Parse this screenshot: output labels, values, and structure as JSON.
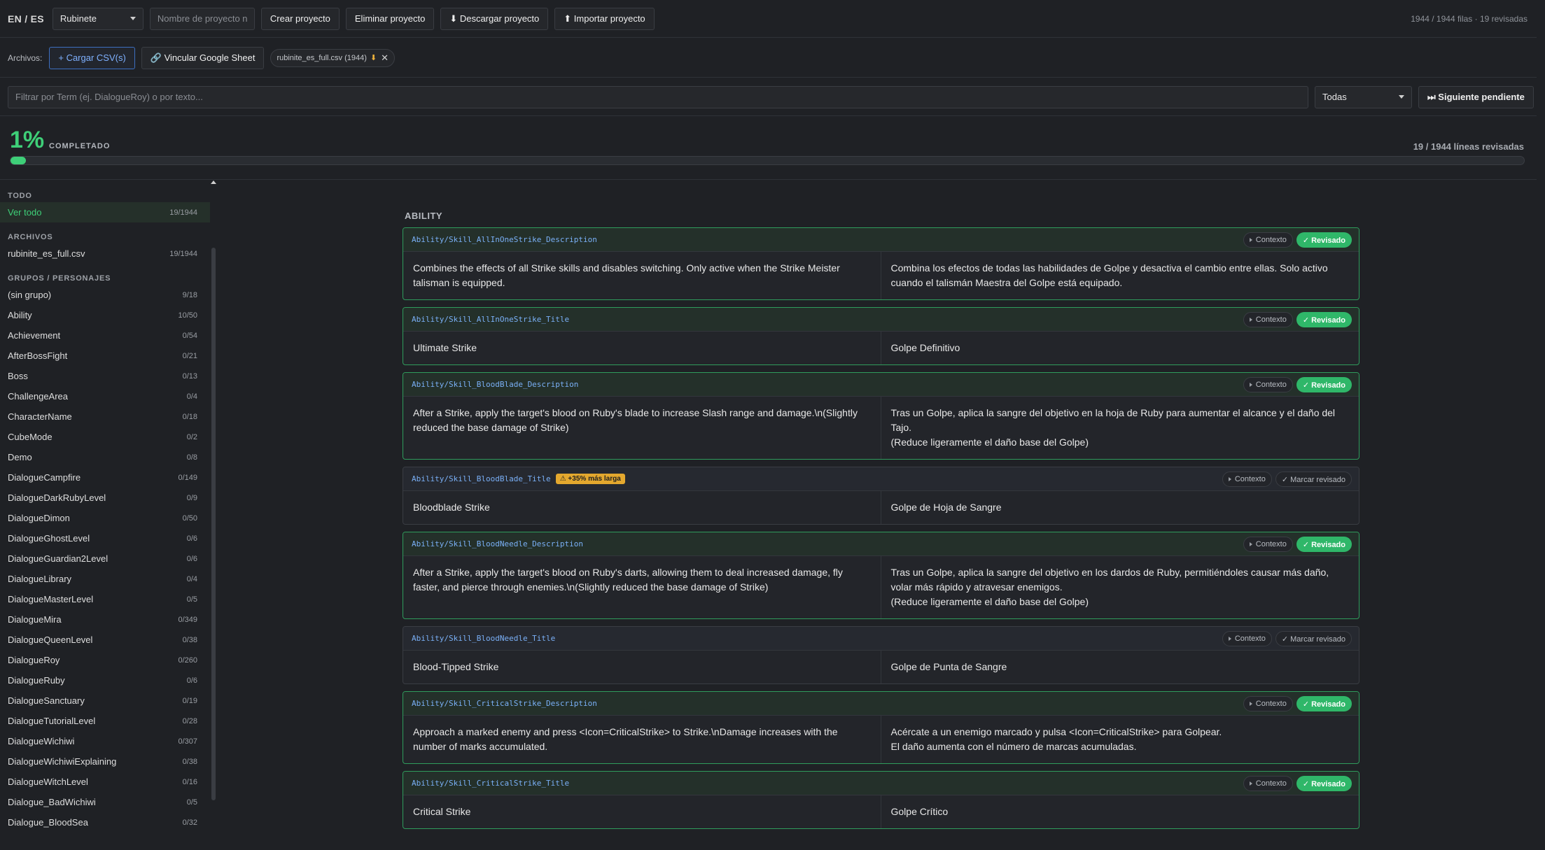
{
  "topbar": {
    "lang": "EN / ES",
    "project_select": "Rubinete",
    "project_name_placeholder": "Nombre de proyecto n",
    "buttons": {
      "create": "Crear proyecto",
      "delete": "Eliminar proyecto",
      "download": "⬇ Descargar proyecto",
      "import": "⬆ Importar proyecto"
    },
    "stats": "1944 / 1944 filas · 19 revisadas"
  },
  "files": {
    "label": "Archivos:",
    "upload": "+ Cargar CSV(s)",
    "link_sheet": "🔗 Vincular Google Sheet",
    "chip": "rubinite_es_full.csv (1944)",
    "chip_warn": "⬇",
    "chip_close": "✕"
  },
  "filter": {
    "placeholder": "Filtrar por Term (ej. DialogueRoy) o por texto...",
    "status": "Todas",
    "next_pending": "⏭ Siguiente pendiente"
  },
  "progress": {
    "percent": "1%",
    "label": "COMPLETADO",
    "count": "19 / 1944 líneas revisadas",
    "fraction": 0.0098
  },
  "sidebar": {
    "todo_title": "TODO",
    "todo_item": {
      "label": "Ver todo",
      "count": "19/1944"
    },
    "files_title": "ARCHIVOS",
    "file_item": {
      "label": "rubinite_es_full.csv",
      "count": "19/1944"
    },
    "groups_title": "GRUPOS / PERSONAJES",
    "groups": [
      {
        "label": "(sin grupo)",
        "count": "9/18"
      },
      {
        "label": "Ability",
        "count": "10/50"
      },
      {
        "label": "Achievement",
        "count": "0/54"
      },
      {
        "label": "AfterBossFight",
        "count": "0/21"
      },
      {
        "label": "Boss",
        "count": "0/13"
      },
      {
        "label": "ChallengeArea",
        "count": "0/4"
      },
      {
        "label": "CharacterName",
        "count": "0/18"
      },
      {
        "label": "CubeMode",
        "count": "0/2"
      },
      {
        "label": "Demo",
        "count": "0/8"
      },
      {
        "label": "DialogueCampfire",
        "count": "0/149"
      },
      {
        "label": "DialogueDarkRubyLevel",
        "count": "0/9"
      },
      {
        "label": "DialogueDimon",
        "count": "0/50"
      },
      {
        "label": "DialogueGhostLevel",
        "count": "0/6"
      },
      {
        "label": "DialogueGuardian2Level",
        "count": "0/6"
      },
      {
        "label": "DialogueLibrary",
        "count": "0/4"
      },
      {
        "label": "DialogueMasterLevel",
        "count": "0/5"
      },
      {
        "label": "DialogueMira",
        "count": "0/349"
      },
      {
        "label": "DialogueQueenLevel",
        "count": "0/38"
      },
      {
        "label": "DialogueRoy",
        "count": "0/260"
      },
      {
        "label": "DialogueRuby",
        "count": "0/6"
      },
      {
        "label": "DialogueSanctuary",
        "count": "0/19"
      },
      {
        "label": "DialogueTutorialLevel",
        "count": "0/28"
      },
      {
        "label": "DialogueWichiwi",
        "count": "0/307"
      },
      {
        "label": "DialogueWichiwiExplaining",
        "count": "0/38"
      },
      {
        "label": "DialogueWitchLevel",
        "count": "0/16"
      },
      {
        "label": "Dialogue_BadWichiwi",
        "count": "0/5"
      },
      {
        "label": "Dialogue_BloodSea",
        "count": "0/32"
      }
    ]
  },
  "main": {
    "section": "ABILITY",
    "context_label": "Contexto",
    "reviewed_label": "✓ Revisado",
    "mark_label": "✓ Marcar revisado",
    "cards": [
      {
        "key": "Ability/Skill_AllInOneStrike_Description",
        "reviewed": true,
        "warn": "",
        "en": "Combines the effects of all Strike skills and disables switching. Only active when the Strike Meister talisman is equipped.",
        "es": "Combina los efectos de todas las habilidades de Golpe y desactiva el cambio entre ellas. Solo activo cuando el talismán Maestra del Golpe está equipado."
      },
      {
        "key": "Ability/Skill_AllInOneStrike_Title",
        "reviewed": true,
        "warn": "",
        "en": "Ultimate Strike",
        "es": "Golpe Definitivo"
      },
      {
        "key": "Ability/Skill_BloodBlade_Description",
        "reviewed": true,
        "warn": "",
        "en": "After a Strike, apply the target's blood on Ruby's blade to increase Slash range and damage.\\n(Slightly reduced the base damage of Strike)",
        "es": "Tras un Golpe, aplica la sangre del objetivo en la hoja de Ruby para aumentar el alcance y el daño del Tajo.\n(Reduce ligeramente el daño base del Golpe)"
      },
      {
        "key": "Ability/Skill_BloodBlade_Title",
        "reviewed": false,
        "warn": "⚠ +35% más larga",
        "en": "Bloodblade Strike",
        "es": "Golpe de Hoja de Sangre"
      },
      {
        "key": "Ability/Skill_BloodNeedle_Description",
        "reviewed": true,
        "warn": "",
        "en": "After a Strike, apply the target's blood on Ruby's darts, allowing them to deal increased damage, fly faster, and pierce through enemies.\\n(Slightly reduced the base damage of Strike)",
        "es": "Tras un Golpe, aplica la sangre del objetivo en los dardos de Ruby, permitiéndoles causar más daño, volar más rápido y atravesar enemigos.\n(Reduce ligeramente el daño base del Golpe)"
      },
      {
        "key": "Ability/Skill_BloodNeedle_Title",
        "reviewed": false,
        "warn": "",
        "en": "Blood-Tipped Strike",
        "es": "Golpe de Punta de Sangre"
      },
      {
        "key": "Ability/Skill_CriticalStrike_Description",
        "reviewed": true,
        "warn": "",
        "en": "Approach a marked enemy and press <Icon=CriticalStrike> to Strike.\\nDamage increases with the number of marks accumulated.",
        "es": "Acércate a un enemigo marcado y pulsa <Icon=CriticalStrike> para Golpear.\nEl daño aumenta con el número de marcas acumuladas."
      },
      {
        "key": "Ability/Skill_CriticalStrike_Title",
        "reviewed": true,
        "warn": "",
        "en": "Critical Strike",
        "es": "Golpe Crítico"
      }
    ]
  },
  "colors": {
    "accent_green": "#3ecf78",
    "review_green": "#2fb769",
    "key_blue": "#7ab0f7",
    "warn_orange": "#e4a82e",
    "background": "#1f2125"
  }
}
